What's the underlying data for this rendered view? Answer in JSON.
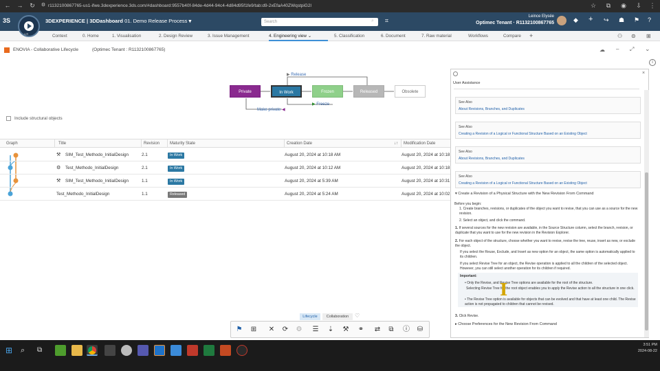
{
  "browser": {
    "url": "r1132100867765-us1-ifwe.3dexperience.3ds.com/#dashboard:9557b40f-84de-4d44-94c4-4d84d95f1fe9/tab:d9-2xEfaA40ZWqstpiG2l"
  },
  "header": {
    "brand": "3DEXPERIENCE",
    "app": "3DDashboard",
    "dashboard": "01. Demo Release Process",
    "search_placeholder": "Search",
    "user_name": "Leince Elysée",
    "tenant": "Optimec Tenant · R1132100867765",
    "compass_version": "V,R"
  },
  "tabs": [
    {
      "label": "Context"
    },
    {
      "label": "0. Home"
    },
    {
      "label": "1. Visualisation"
    },
    {
      "label": "2. Design Review"
    },
    {
      "label": "3. Issue Management"
    },
    {
      "label": "4. Engineering view"
    },
    {
      "label": "5. Classification"
    },
    {
      "label": "6. Document"
    },
    {
      "label": "7. Raw material"
    },
    {
      "label": "Workflows"
    },
    {
      "label": "Compare"
    }
  ],
  "widget": {
    "title": "ENOVIA - Collaborative Lifecycle",
    "context": "(Optimec Tenant : R1132100867765)",
    "include_structural": "Include structural objects"
  },
  "states": {
    "private": "Private",
    "in_work": "In Work",
    "frozen": "Frozen",
    "released": "Released",
    "obsolete": "Obsolete",
    "release_label": "Release",
    "freeze_label": "Freeze",
    "make_private_label": "Make private"
  },
  "table": {
    "headers": {
      "graph": "Graph",
      "title": "Title",
      "revision": "Revision",
      "maturity": "Maturity State",
      "creation": "Creation Date",
      "modification": "Modification Date"
    },
    "rows": [
      {
        "title": "SIM_Test_Methodo_InitialDesign",
        "revision": "2.1",
        "state": "In Work",
        "created": "August 20, 2024 at 10:18 AM",
        "modified": "August 20, 2024 at 10:18 A"
      },
      {
        "title": "Test_Methodo_InitialDesign",
        "revision": "2.1",
        "state": "In Work",
        "created": "August 20, 2024 at 10:12 AM",
        "modified": "August 20, 2024 at 10:18 A"
      },
      {
        "title": "SIM_Test_Methodo_InitialDesign",
        "revision": "1.1",
        "state": "In Work",
        "created": "August 20, 2024 at 5:39 AM",
        "modified": "August 20, 2024 at 10:31 A"
      },
      {
        "title": "Test_Methodo_InitialDesign",
        "revision": "1.1",
        "state": "Released",
        "created": "August 20, 2024 at 5:24 AM",
        "modified": "August 20, 2024 at 10:02 A"
      }
    ]
  },
  "assist": {
    "title": "User Assistance",
    "see_also": [
      {
        "heading": "See Also",
        "link": "About Revisions, Branches, and Duplicates"
      },
      {
        "heading": "See Also",
        "link": "Creating a Revision of a Logical or Functional Structure Based on an Existing Object"
      },
      {
        "heading": "See Also",
        "link": "About Revisions, Branches, and Duplicates"
      },
      {
        "heading": "See Also",
        "link": "Creating a Revision of a Logical or Functional Structure Based on an Existing Object"
      }
    ],
    "section_title": "Create a Revision of a Physical Structure with the New Revision From Command",
    "before_begin": "Before you begin:",
    "bb1": "Create branches, revisions, or duplicates of the object you want to revise, that you can use as a source for the new revision.",
    "bb2": "Select an object, and click the command.",
    "step1": "If several sources for the new revision are available, in the Source Structure column, select the branch, revision, or duplicate that you want to use for the new revision in the Revision Explorer.",
    "step2": "For each object of the structure, choose whether you want to revise, revise the tree, reuse, insert as new, or exclude the object.",
    "p1": "If you select the Reuse, Exclude, and Insert as new option for an object, the same option is automatically applied to its children.",
    "p2": "If you select Revise Tree for an object, the Revise operation is applied to all the children of the selected object. However, you can still select another operation for its children if required.",
    "important": "Important:",
    "imp1": "Only the Revise, and Revise Tree options are available for the root of the structure.",
    "imp1b": "Selecting Revise Tree for the root object enables you to apply the Revise action to all the structure in one click.",
    "imp2": "The Revise Tree option is available for objects that can be evolved and that have at least one child. The Revise action is not propagated to children that cannot be revised.",
    "step3": "Click Revise.",
    "footer": "Choose Preferences for the New Revision From Command"
  },
  "lifecycle_tabs": {
    "lifecycle": "Lifecycle",
    "collaboration": "Collaboration"
  },
  "clock": {
    "time": "3:51 PM",
    "date": "2024-08-22"
  }
}
